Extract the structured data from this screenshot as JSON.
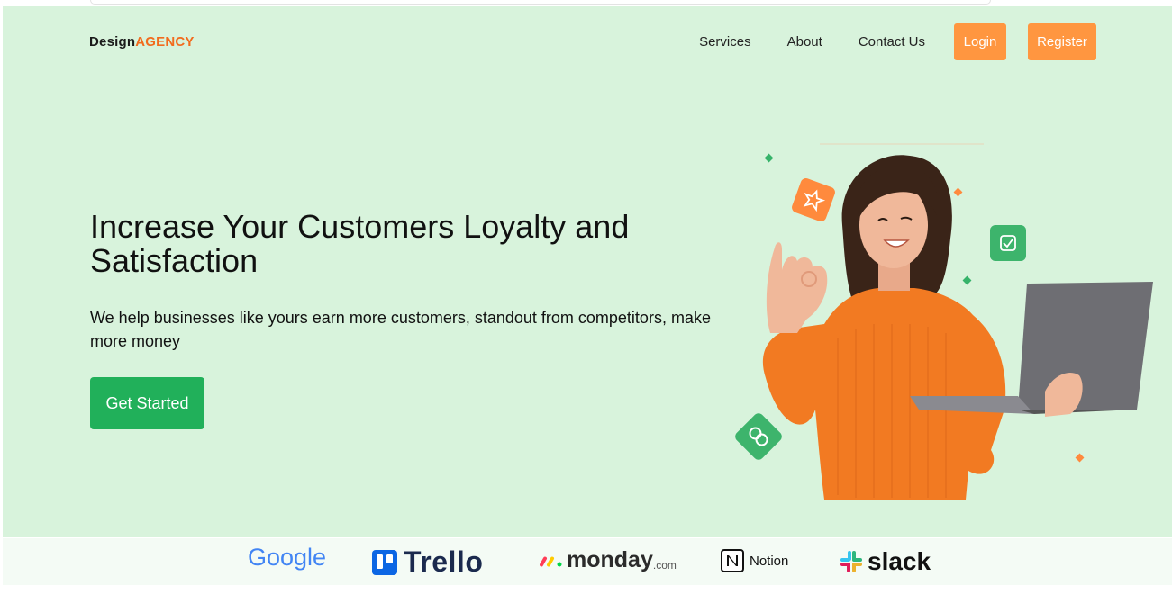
{
  "brand": {
    "name_part1": "Design",
    "name_part2": "AGENCY"
  },
  "nav": {
    "items": [
      "Services",
      "About",
      "Contact Us"
    ],
    "login_label": "Login",
    "register_label": "Register"
  },
  "hero": {
    "headline": "Increase Your Customers Loyalty and Satisfaction",
    "subtext": "We help businesses like yours earn more customers, standout from competitors, make more money",
    "cta_label": "Get Started"
  },
  "partners": {
    "google": "Google",
    "trello": "Trello",
    "monday": "monday",
    "monday_suffix": ".com",
    "notion": "Notion",
    "slack": "slack"
  },
  "colors": {
    "hero_bg": "#d8f3dc",
    "accent_orange": "#ff9640",
    "cta_green": "#21b05a"
  }
}
